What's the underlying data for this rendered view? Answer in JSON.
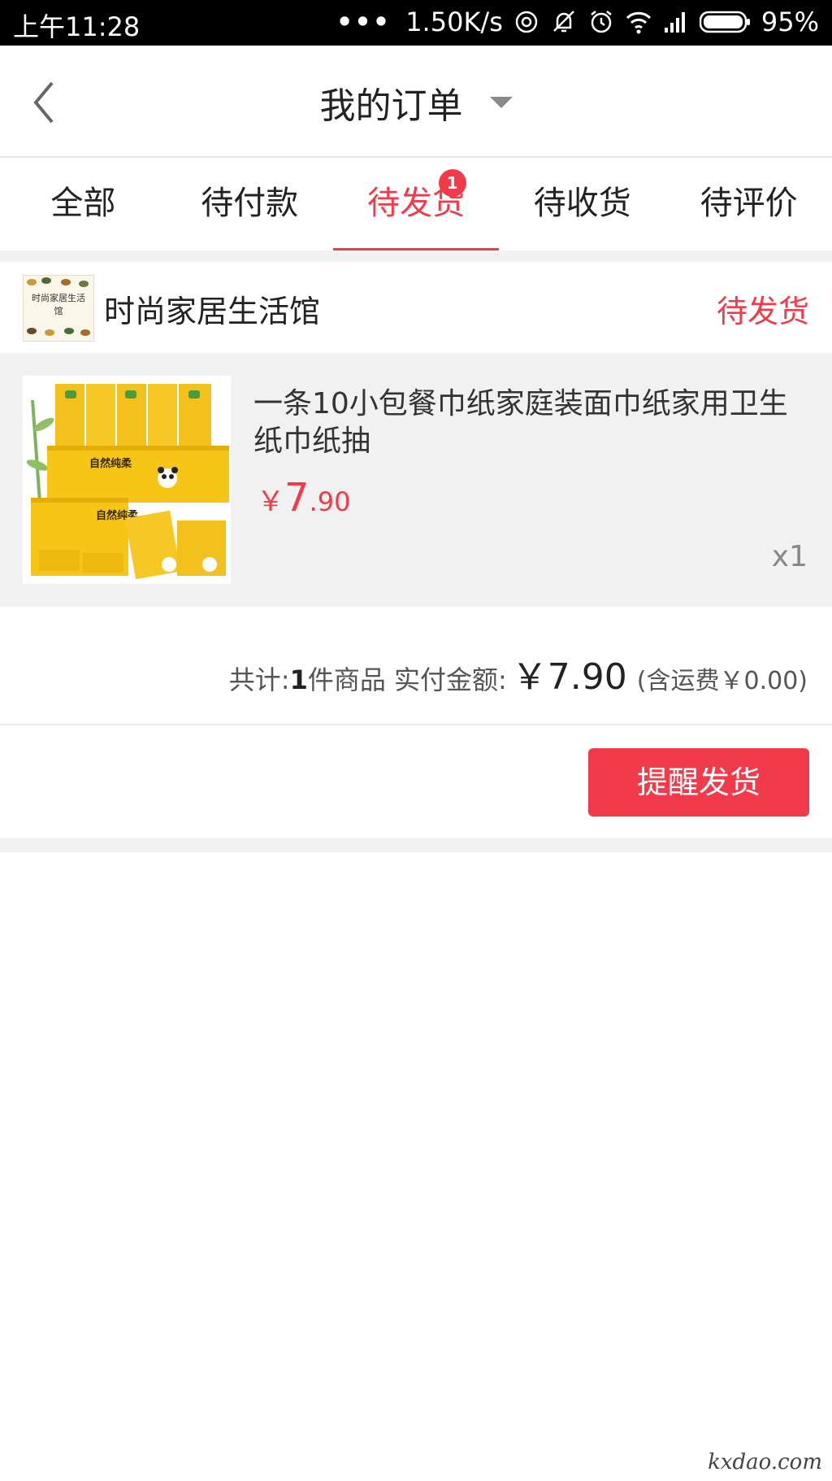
{
  "status_bar": {
    "time": "上午11:28",
    "dots": "•••",
    "speed": "1.50K/s",
    "battery": "95%",
    "icons": [
      "hotspot-icon",
      "mute-bell-icon",
      "alarm-icon",
      "wifi-icon",
      "signal-icon",
      "battery-icon"
    ]
  },
  "header": {
    "title": "我的订单",
    "back_icon": "chevron-left-icon",
    "dropdown_icon": "caret-down-icon"
  },
  "tabs": [
    {
      "label": "全部"
    },
    {
      "label": "待付款"
    },
    {
      "label": "待发货",
      "badge": "1",
      "active": true
    },
    {
      "label": "待收货"
    },
    {
      "label": "待评价"
    }
  ],
  "order": {
    "store": {
      "logo_text": "时尚家居生活馆",
      "name": "时尚家居生活馆",
      "status": "待发货"
    },
    "product": {
      "name": "一条10小包餐巾纸家庭装面巾纸家用卫生纸巾纸抽",
      "price_symbol": "￥",
      "price_int": "7",
      "price_dec": ".90",
      "quantity": "x1",
      "image_text_1": "自然纯柔",
      "image_text_2": "自然纯柔"
    },
    "summary": {
      "count_prefix": "共计:",
      "count": "1",
      "count_suffix": "件商品 实付金额:",
      "total": "￥7.90",
      "shipping": "(含运费￥0.00)"
    },
    "action": {
      "remind_label": "提醒发货"
    }
  },
  "colors": {
    "accent": "#f23b4a",
    "product_bg": "#f1f1f1",
    "divider": "#f2f2f2"
  },
  "watermark": "kxdao.com"
}
